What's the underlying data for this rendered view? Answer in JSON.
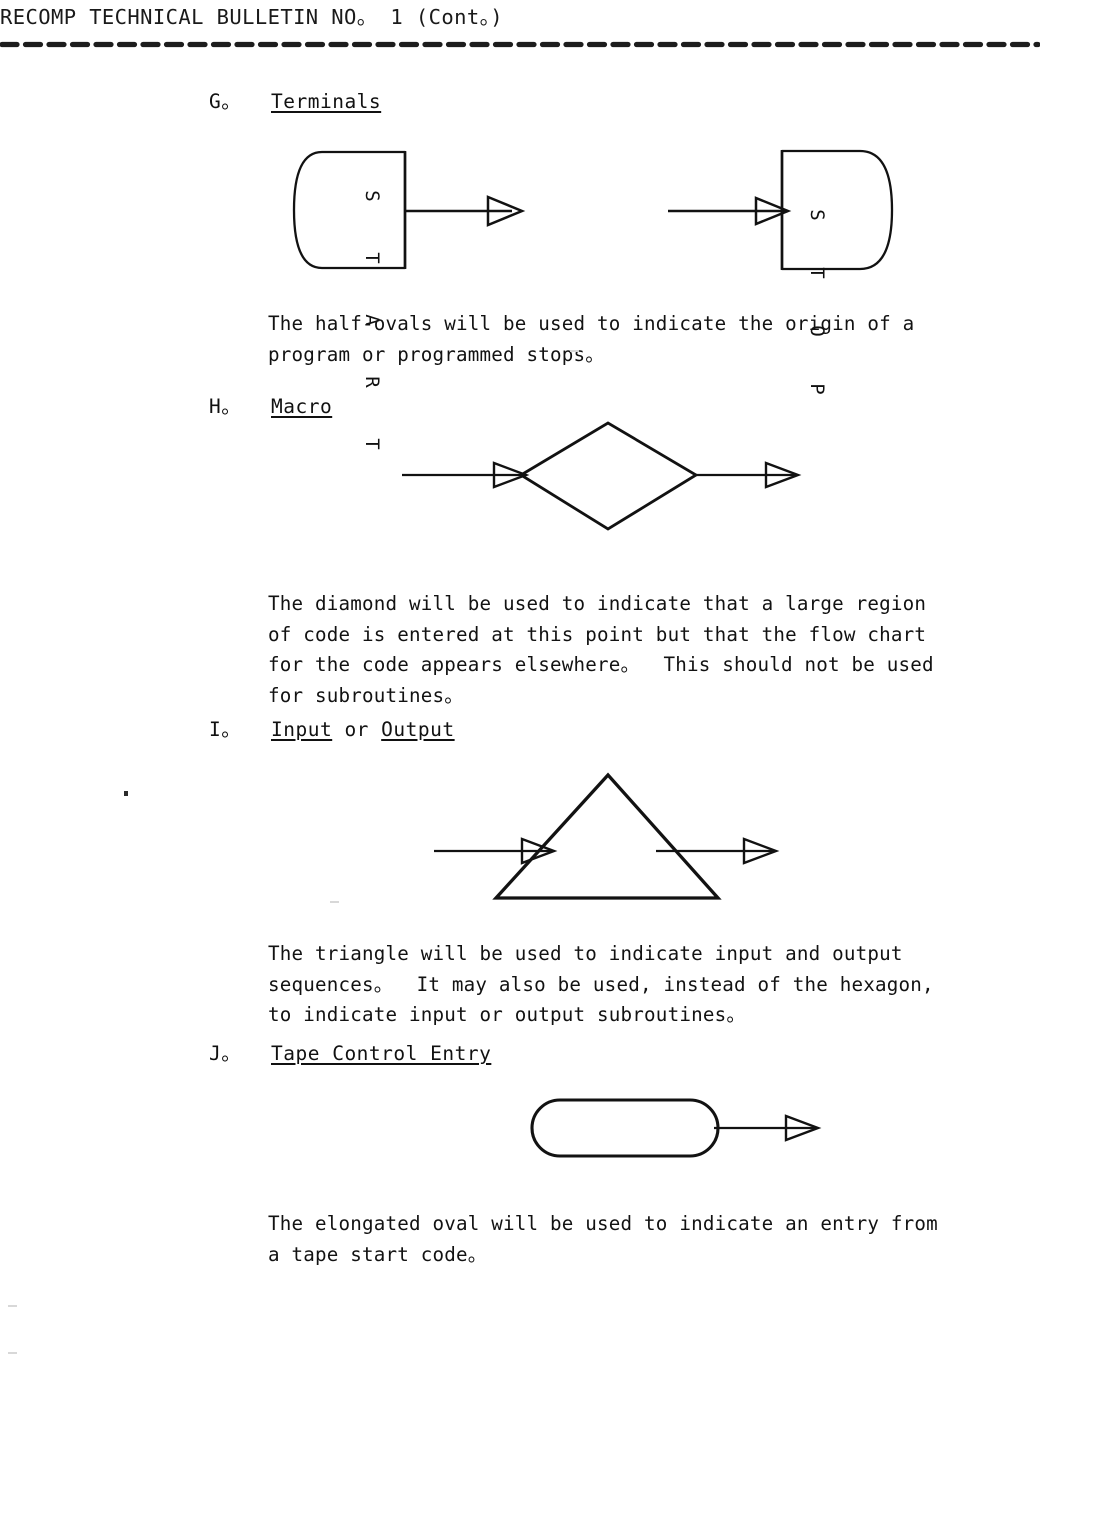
{
  "document": {
    "header": "RECOMP TECHNICAL BULLETIN NO。 1 (Cont。)",
    "background_color": "#ffffff",
    "ink_color": "#111111"
  },
  "sections": [
    {
      "letter": "G。",
      "title": "Terminals",
      "title_underlined": true,
      "figure": "terminals",
      "body": "The half-ovals will be used to indicate the origin of a\nprogram or programmed stops。"
    },
    {
      "letter": "H。",
      "title": "Macro",
      "title_underlined": true,
      "figure": "diamond",
      "body": "The diamond will be used to indicate that a large region\nof code is entered at this point but that the flow chart\nfor the code appears elsewhere。  This should not be used\nfor subroutines。"
    },
    {
      "letter": "I。",
      "title_parts": [
        {
          "text": "Input",
          "underlined": true
        },
        {
          "text": " or ",
          "underlined": false
        },
        {
          "text": "Output",
          "underlined": true
        }
      ],
      "figure": "triangle",
      "body": "The triangle will be used to indicate input and output\nsequences。  It may also be used, instead of the hexagon,\nto indicate input or output subroutines。"
    },
    {
      "letter": "J。",
      "title": "Tape Control Entry",
      "title_underlined": true,
      "figure": "oval",
      "body": "The elongated oval will be used to indicate an entry from\na tape start code。"
    }
  ],
  "figures": {
    "terminals": {
      "start_label": "START",
      "start_letters": [
        "S",
        "T",
        "A",
        "R",
        "T"
      ],
      "stop_label": "STOP",
      "stop_letters": [
        "S",
        "T",
        "O",
        "P"
      ],
      "start_shape": "half-oval-rounded-left",
      "stop_shape": "half-oval-rounded-right",
      "arrows": 2
    },
    "diamond": {
      "shape": "diamond",
      "inbound_arrow": true,
      "outbound_arrow": true
    },
    "triangle": {
      "shape": "triangle",
      "inbound_arrow": true,
      "outbound_arrow": true
    },
    "oval": {
      "shape": "elongated-oval",
      "outbound_arrow": true
    }
  }
}
